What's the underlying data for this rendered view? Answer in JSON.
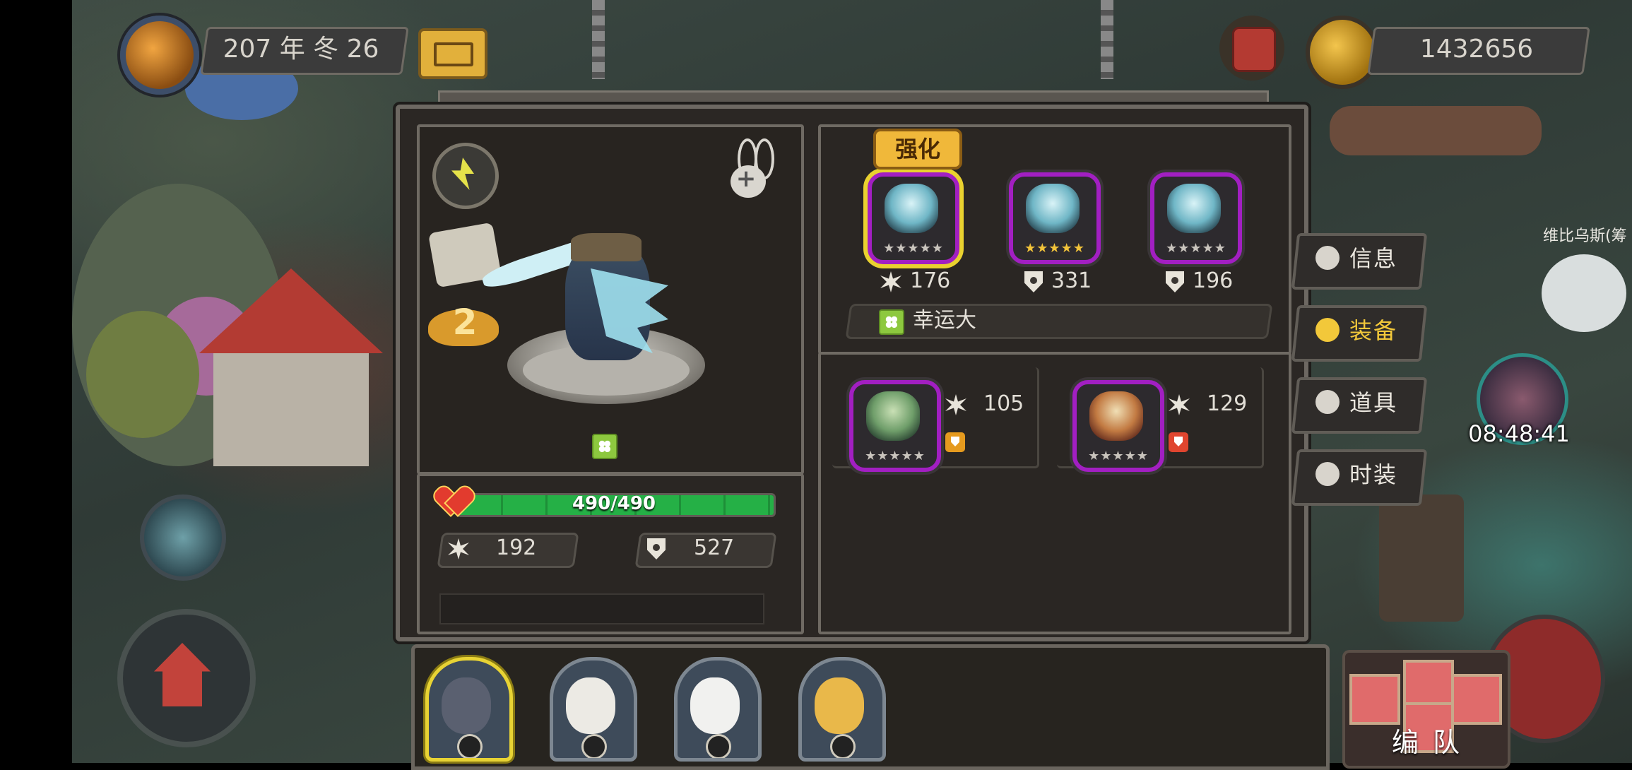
{
  "top_bar": {
    "date": "207 年 冬 26",
    "gold": "1432656"
  },
  "hero": {
    "rank": "2",
    "hp": "490/490",
    "hp_fraction": 1.0,
    "attack": "192",
    "defense": "527"
  },
  "equipment": {
    "enhance_label": "强化",
    "slots": [
      {
        "stat_icon": "attack-icon",
        "value": "176",
        "stars": "★★★★★",
        "stars_gold": false
      },
      {
        "stat_icon": "defense-icon",
        "value": "331",
        "stars": "★★★★★",
        "stars_gold": true
      },
      {
        "stat_icon": "defense-icon",
        "value": "196",
        "stars": "★★★★★",
        "stars_gold": false
      }
    ],
    "trait_label": "幸运大",
    "accessories": [
      {
        "stat_icon": "attack-icon",
        "value": "105",
        "badge_color": "#e59a1e",
        "stars": "★★★★★"
      },
      {
        "stat_icon": "attack-icon",
        "value": "129",
        "badge_color": "#e0452f",
        "stars": "★★★★★"
      }
    ]
  },
  "side_tabs": [
    {
      "label": "信息",
      "icon": "info-icon",
      "active": false
    },
    {
      "label": "装备",
      "icon": "helmet-icon",
      "active": true
    },
    {
      "label": "道具",
      "icon": "potion-icon",
      "active": false
    },
    {
      "label": "时装",
      "icon": "shirt-icon",
      "active": false
    }
  ],
  "world": {
    "npc_name": "维比乌斯(筹",
    "timer": "08:48:41"
  },
  "team": {
    "label": "编 队"
  },
  "colors": {
    "equip_frame": "#a21fc2",
    "active_tab": "#f2c83a",
    "hp_green": "#25b046"
  }
}
